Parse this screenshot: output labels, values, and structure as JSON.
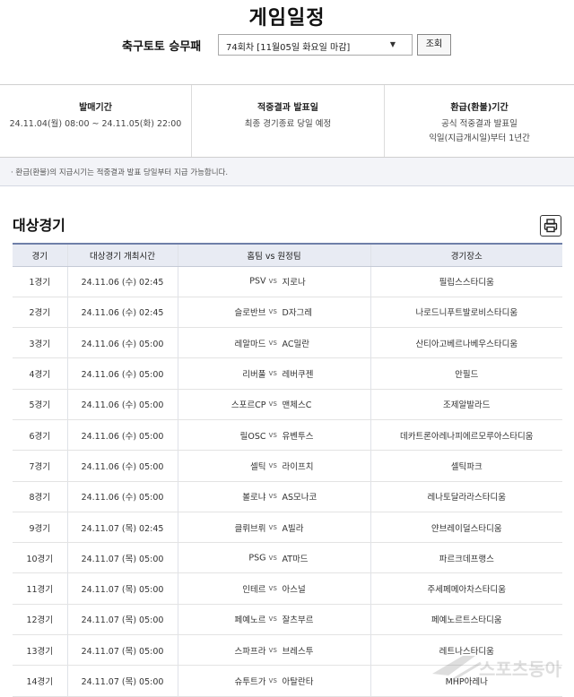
{
  "page": {
    "title": "게임일정"
  },
  "selector": {
    "game_label": "축구토토 승무패",
    "round_value": "74회차 [11월05일 화요일 마감]",
    "search_label": "조회"
  },
  "info": [
    {
      "head": "발매기간",
      "lines": [
        "24.11.04(월) 08:00 ~ 24.11.05(화) 22:00"
      ]
    },
    {
      "head": "적중결과 발표일",
      "lines": [
        "최종 경기종료 당일 예정"
      ]
    },
    {
      "head": "환급(환불)기간",
      "lines": [
        "공식 적중결과 발표일",
        "익일(지급개시일)부터 1년간"
      ]
    }
  ],
  "notice": "· 환급(환불)의 지급시기는 적중결과 발표 당일부터 지급 가능합니다.",
  "section": {
    "title": "대상경기",
    "print_icon": "printer-icon"
  },
  "table": {
    "headers": {
      "game": "경기",
      "time": "대상경기 개최시간",
      "teams": "홈팀 vs 원정팀",
      "venue": "경기장소"
    },
    "vs": "vs",
    "rows": [
      {
        "game": "1경기",
        "time": "24.11.06 (수) 02:45",
        "home": "PSV",
        "away": "지로나",
        "venue": "필립스스타디움"
      },
      {
        "game": "2경기",
        "time": "24.11.06 (수) 02:45",
        "home": "슬로반브",
        "away": "D자그레",
        "venue": "나로드니푸트발로비스타디움"
      },
      {
        "game": "3경기",
        "time": "24.11.06 (수) 05:00",
        "home": "레알마드",
        "away": "AC밀란",
        "venue": "산티아고베르나베우스타디움"
      },
      {
        "game": "4경기",
        "time": "24.11.06 (수) 05:00",
        "home": "리버풀",
        "away": "레버쿠젠",
        "venue": "안필드"
      },
      {
        "game": "5경기",
        "time": "24.11.06 (수) 05:00",
        "home": "스포르CP",
        "away": "맨체스C",
        "venue": "조제알발라드"
      },
      {
        "game": "6경기",
        "time": "24.11.06 (수) 05:00",
        "home": "릴OSC",
        "away": "유벤투스",
        "venue": "데카트론아레나피에르모루아스타디움"
      },
      {
        "game": "7경기",
        "time": "24.11.06 (수) 05:00",
        "home": "셀틱",
        "away": "라이프치",
        "venue": "셀틱파크"
      },
      {
        "game": "8경기",
        "time": "24.11.06 (수) 05:00",
        "home": "볼로냐",
        "away": "AS모나코",
        "venue": "레나토달라라스타디움"
      },
      {
        "game": "9경기",
        "time": "24.11.07 (목) 02:45",
        "home": "클뤼브뤼",
        "away": "A빌라",
        "venue": "얀브레이덜스타디움"
      },
      {
        "game": "10경기",
        "time": "24.11.07 (목) 05:00",
        "home": "PSG",
        "away": "AT마드",
        "venue": "파르크데프랭스"
      },
      {
        "game": "11경기",
        "time": "24.11.07 (목) 05:00",
        "home": "인테르",
        "away": "아스널",
        "venue": "주세페메아차스타디움"
      },
      {
        "game": "12경기",
        "time": "24.11.07 (목) 05:00",
        "home": "페예노르",
        "away": "잘츠부르",
        "venue": "페예노르트스타디움"
      },
      {
        "game": "13경기",
        "time": "24.11.07 (목) 05:00",
        "home": "스파프라",
        "away": "브레스투",
        "venue": "레트나스타디움"
      },
      {
        "game": "14경기",
        "time": "24.11.07 (목) 05:00",
        "home": "슈투트가",
        "away": "아탈란타",
        "venue": "MHP아레나"
      }
    ]
  },
  "watermark": {
    "text": "스포츠동아"
  }
}
